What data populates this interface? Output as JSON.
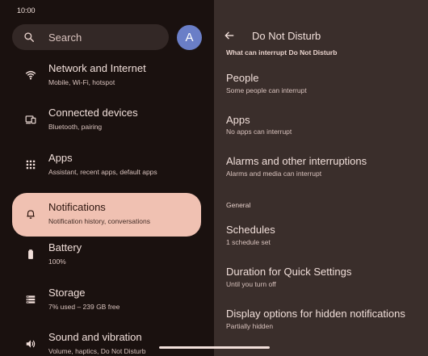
{
  "status_bar": {
    "time": "10:00",
    "icons": [
      "wifi-icon",
      "signal-icon",
      "battery-icon"
    ]
  },
  "search": {
    "label": "Search",
    "icon": "search-icon"
  },
  "avatar": {
    "letter": "A",
    "color": "#6a7ec7"
  },
  "sidebar": {
    "items": [
      {
        "title": "Network and Internet",
        "subtitle": "Mobile, Wi-Fi, hotspot",
        "icon": "wifi-icon"
      },
      {
        "title": "Connected devices",
        "subtitle": "Bluetooth, pairing",
        "icon": "devices-icon"
      },
      {
        "title": "Apps",
        "subtitle": "Assistant, recent apps, default apps",
        "icon": "apps-grid-icon"
      },
      {
        "title": "Notifications",
        "subtitle": "Notification history, conversations",
        "icon": "bell-icon",
        "active": true
      },
      {
        "title": "Battery",
        "subtitle": "100%",
        "icon": "battery-icon"
      },
      {
        "title": "Storage",
        "subtitle": "7% used – 239 GB free",
        "icon": "storage-icon"
      },
      {
        "title": "Sound and vibration",
        "subtitle": "Volume, haptics, Do Not Disturb",
        "icon": "volume-icon"
      }
    ]
  },
  "detail": {
    "title": "Do Not Disturb",
    "back_icon": "back-arrow-icon",
    "section1": "What can interrupt Do Not Disturb",
    "section2": "General",
    "items": [
      {
        "title": "People",
        "subtitle": "Some people can interrupt"
      },
      {
        "title": "Apps",
        "subtitle": "No apps can interrupt"
      },
      {
        "title": "Alarms and other interruptions",
        "subtitle": "Alarms and media can interrupt"
      },
      {
        "title": "Schedules",
        "subtitle": "1 schedule set"
      },
      {
        "title": "Duration for Quick Settings",
        "subtitle": "Until you turn off"
      },
      {
        "title": "Display options for hidden notifications",
        "subtitle": "Partially hidden"
      }
    ]
  },
  "colors": {
    "accent": "#f0c1b2",
    "left_bg": "#1a110f",
    "right_bg": "#3a2e2b"
  }
}
